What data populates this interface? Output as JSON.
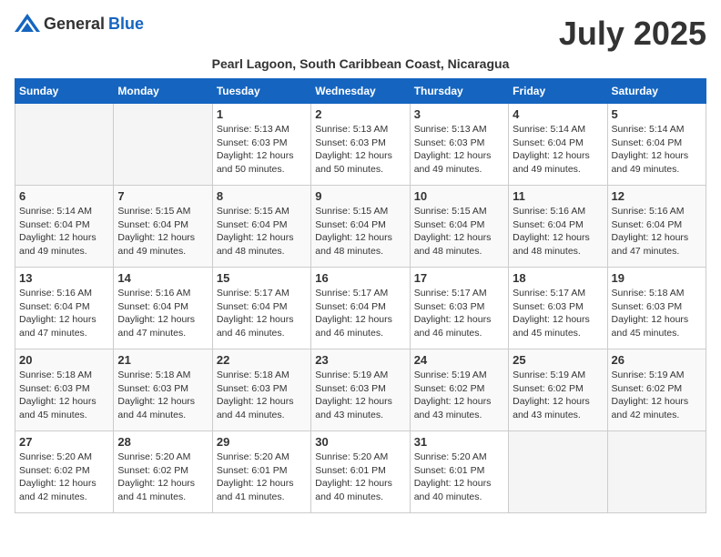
{
  "header": {
    "logo_general": "General",
    "logo_blue": "Blue",
    "month_title": "July 2025",
    "location": "Pearl Lagoon, South Caribbean Coast, Nicaragua"
  },
  "days_of_week": [
    "Sunday",
    "Monday",
    "Tuesday",
    "Wednesday",
    "Thursday",
    "Friday",
    "Saturday"
  ],
  "weeks": [
    [
      {
        "day": "",
        "empty": true
      },
      {
        "day": "",
        "empty": true
      },
      {
        "day": "1",
        "sunrise": "Sunrise: 5:13 AM",
        "sunset": "Sunset: 6:03 PM",
        "daylight": "Daylight: 12 hours and 50 minutes."
      },
      {
        "day": "2",
        "sunrise": "Sunrise: 5:13 AM",
        "sunset": "Sunset: 6:03 PM",
        "daylight": "Daylight: 12 hours and 50 minutes."
      },
      {
        "day": "3",
        "sunrise": "Sunrise: 5:13 AM",
        "sunset": "Sunset: 6:03 PM",
        "daylight": "Daylight: 12 hours and 49 minutes."
      },
      {
        "day": "4",
        "sunrise": "Sunrise: 5:14 AM",
        "sunset": "Sunset: 6:04 PM",
        "daylight": "Daylight: 12 hours and 49 minutes."
      },
      {
        "day": "5",
        "sunrise": "Sunrise: 5:14 AM",
        "sunset": "Sunset: 6:04 PM",
        "daylight": "Daylight: 12 hours and 49 minutes."
      }
    ],
    [
      {
        "day": "6",
        "sunrise": "Sunrise: 5:14 AM",
        "sunset": "Sunset: 6:04 PM",
        "daylight": "Daylight: 12 hours and 49 minutes."
      },
      {
        "day": "7",
        "sunrise": "Sunrise: 5:15 AM",
        "sunset": "Sunset: 6:04 PM",
        "daylight": "Daylight: 12 hours and 49 minutes."
      },
      {
        "day": "8",
        "sunrise": "Sunrise: 5:15 AM",
        "sunset": "Sunset: 6:04 PM",
        "daylight": "Daylight: 12 hours and 48 minutes."
      },
      {
        "day": "9",
        "sunrise": "Sunrise: 5:15 AM",
        "sunset": "Sunset: 6:04 PM",
        "daylight": "Daylight: 12 hours and 48 minutes."
      },
      {
        "day": "10",
        "sunrise": "Sunrise: 5:15 AM",
        "sunset": "Sunset: 6:04 PM",
        "daylight": "Daylight: 12 hours and 48 minutes."
      },
      {
        "day": "11",
        "sunrise": "Sunrise: 5:16 AM",
        "sunset": "Sunset: 6:04 PM",
        "daylight": "Daylight: 12 hours and 48 minutes."
      },
      {
        "day": "12",
        "sunrise": "Sunrise: 5:16 AM",
        "sunset": "Sunset: 6:04 PM",
        "daylight": "Daylight: 12 hours and 47 minutes."
      }
    ],
    [
      {
        "day": "13",
        "sunrise": "Sunrise: 5:16 AM",
        "sunset": "Sunset: 6:04 PM",
        "daylight": "Daylight: 12 hours and 47 minutes."
      },
      {
        "day": "14",
        "sunrise": "Sunrise: 5:16 AM",
        "sunset": "Sunset: 6:04 PM",
        "daylight": "Daylight: 12 hours and 47 minutes."
      },
      {
        "day": "15",
        "sunrise": "Sunrise: 5:17 AM",
        "sunset": "Sunset: 6:04 PM",
        "daylight": "Daylight: 12 hours and 46 minutes."
      },
      {
        "day": "16",
        "sunrise": "Sunrise: 5:17 AM",
        "sunset": "Sunset: 6:04 PM",
        "daylight": "Daylight: 12 hours and 46 minutes."
      },
      {
        "day": "17",
        "sunrise": "Sunrise: 5:17 AM",
        "sunset": "Sunset: 6:03 PM",
        "daylight": "Daylight: 12 hours and 46 minutes."
      },
      {
        "day": "18",
        "sunrise": "Sunrise: 5:17 AM",
        "sunset": "Sunset: 6:03 PM",
        "daylight": "Daylight: 12 hours and 45 minutes."
      },
      {
        "day": "19",
        "sunrise": "Sunrise: 5:18 AM",
        "sunset": "Sunset: 6:03 PM",
        "daylight": "Daylight: 12 hours and 45 minutes."
      }
    ],
    [
      {
        "day": "20",
        "sunrise": "Sunrise: 5:18 AM",
        "sunset": "Sunset: 6:03 PM",
        "daylight": "Daylight: 12 hours and 45 minutes."
      },
      {
        "day": "21",
        "sunrise": "Sunrise: 5:18 AM",
        "sunset": "Sunset: 6:03 PM",
        "daylight": "Daylight: 12 hours and 44 minutes."
      },
      {
        "day": "22",
        "sunrise": "Sunrise: 5:18 AM",
        "sunset": "Sunset: 6:03 PM",
        "daylight": "Daylight: 12 hours and 44 minutes."
      },
      {
        "day": "23",
        "sunrise": "Sunrise: 5:19 AM",
        "sunset": "Sunset: 6:03 PM",
        "daylight": "Daylight: 12 hours and 43 minutes."
      },
      {
        "day": "24",
        "sunrise": "Sunrise: 5:19 AM",
        "sunset": "Sunset: 6:02 PM",
        "daylight": "Daylight: 12 hours and 43 minutes."
      },
      {
        "day": "25",
        "sunrise": "Sunrise: 5:19 AM",
        "sunset": "Sunset: 6:02 PM",
        "daylight": "Daylight: 12 hours and 43 minutes."
      },
      {
        "day": "26",
        "sunrise": "Sunrise: 5:19 AM",
        "sunset": "Sunset: 6:02 PM",
        "daylight": "Daylight: 12 hours and 42 minutes."
      }
    ],
    [
      {
        "day": "27",
        "sunrise": "Sunrise: 5:20 AM",
        "sunset": "Sunset: 6:02 PM",
        "daylight": "Daylight: 12 hours and 42 minutes."
      },
      {
        "day": "28",
        "sunrise": "Sunrise: 5:20 AM",
        "sunset": "Sunset: 6:02 PM",
        "daylight": "Daylight: 12 hours and 41 minutes."
      },
      {
        "day": "29",
        "sunrise": "Sunrise: 5:20 AM",
        "sunset": "Sunset: 6:01 PM",
        "daylight": "Daylight: 12 hours and 41 minutes."
      },
      {
        "day": "30",
        "sunrise": "Sunrise: 5:20 AM",
        "sunset": "Sunset: 6:01 PM",
        "daylight": "Daylight: 12 hours and 40 minutes."
      },
      {
        "day": "31",
        "sunrise": "Sunrise: 5:20 AM",
        "sunset": "Sunset: 6:01 PM",
        "daylight": "Daylight: 12 hours and 40 minutes."
      },
      {
        "day": "",
        "empty": true
      },
      {
        "day": "",
        "empty": true
      }
    ]
  ]
}
